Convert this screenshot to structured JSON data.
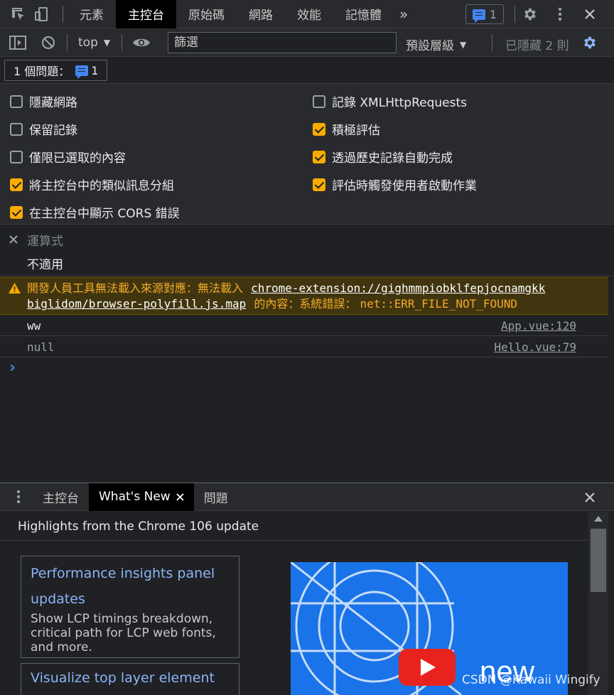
{
  "topbar": {
    "tabs": [
      {
        "label": "元素"
      },
      {
        "label": "主控台"
      },
      {
        "label": "原始碼"
      },
      {
        "label": "網路"
      },
      {
        "label": "效能"
      },
      {
        "label": "記憶體"
      }
    ],
    "more_glyph": "»",
    "issue_count": "1"
  },
  "toolbar": {
    "context": "top",
    "filter_placeholder": "篩選",
    "log_levels": "預設層級",
    "hidden_count": "已隱藏 2 則"
  },
  "issues": {
    "label": "1 個問題：",
    "count": "1"
  },
  "settings": {
    "left": [
      {
        "label": "隱藏網路",
        "checked": false
      },
      {
        "label": "保留記錄",
        "checked": false
      },
      {
        "label": "僅限已選取的內容",
        "checked": false
      },
      {
        "label": "將主控台中的類似訊息分組",
        "checked": true
      },
      {
        "label": "在主控台中顯示 CORS 錯誤",
        "checked": true
      }
    ],
    "right": [
      {
        "label": "記錄 XMLHttpRequests",
        "checked": false
      },
      {
        "label": "積極評估",
        "checked": true
      },
      {
        "label": "透過歷史記錄自動完成",
        "checked": true
      },
      {
        "label": "評估時觸發使用者啟動作業",
        "checked": true
      }
    ]
  },
  "expression": {
    "label": "運算式",
    "value": "不適用"
  },
  "warning": {
    "text_prefix": "開發人員工具無法載入來源對應：無法載入",
    "link_part1": "chrome-extension://gighmmpiobklfepjocnamgkk",
    "link_part2": "biglidom/browser-polyfill.js.map",
    "text_mid": "的內容：系統錯誤：",
    "error_code": "net::ERR_FILE_NOT_FOUND"
  },
  "logs": [
    {
      "message": "ww",
      "source": "App.vue:120"
    },
    {
      "message": "null",
      "source": "Hello.vue:79"
    }
  ],
  "prompt_glyph": "›",
  "drawer": {
    "tabs": [
      {
        "label": "主控台"
      },
      {
        "label": "What's New"
      },
      {
        "label": "問題"
      }
    ]
  },
  "whats_new": {
    "header": "Highlights from the Chrome 106 update",
    "cards": [
      {
        "title": "Performance insights panel updates",
        "description": "Show LCP timings breakdown, critical path for LCP web fonts, and more."
      },
      {
        "title": "Visualize top layer element in",
        "description": ""
      }
    ],
    "media_text": "new"
  },
  "watermark": "CSDN @Kawaii Wingify",
  "colors": {
    "accent_blue": "#8ab4f8",
    "checkbox_orange": "#f9ab00",
    "warning_text": "#f2ab26",
    "warning_bg": "#413510"
  }
}
